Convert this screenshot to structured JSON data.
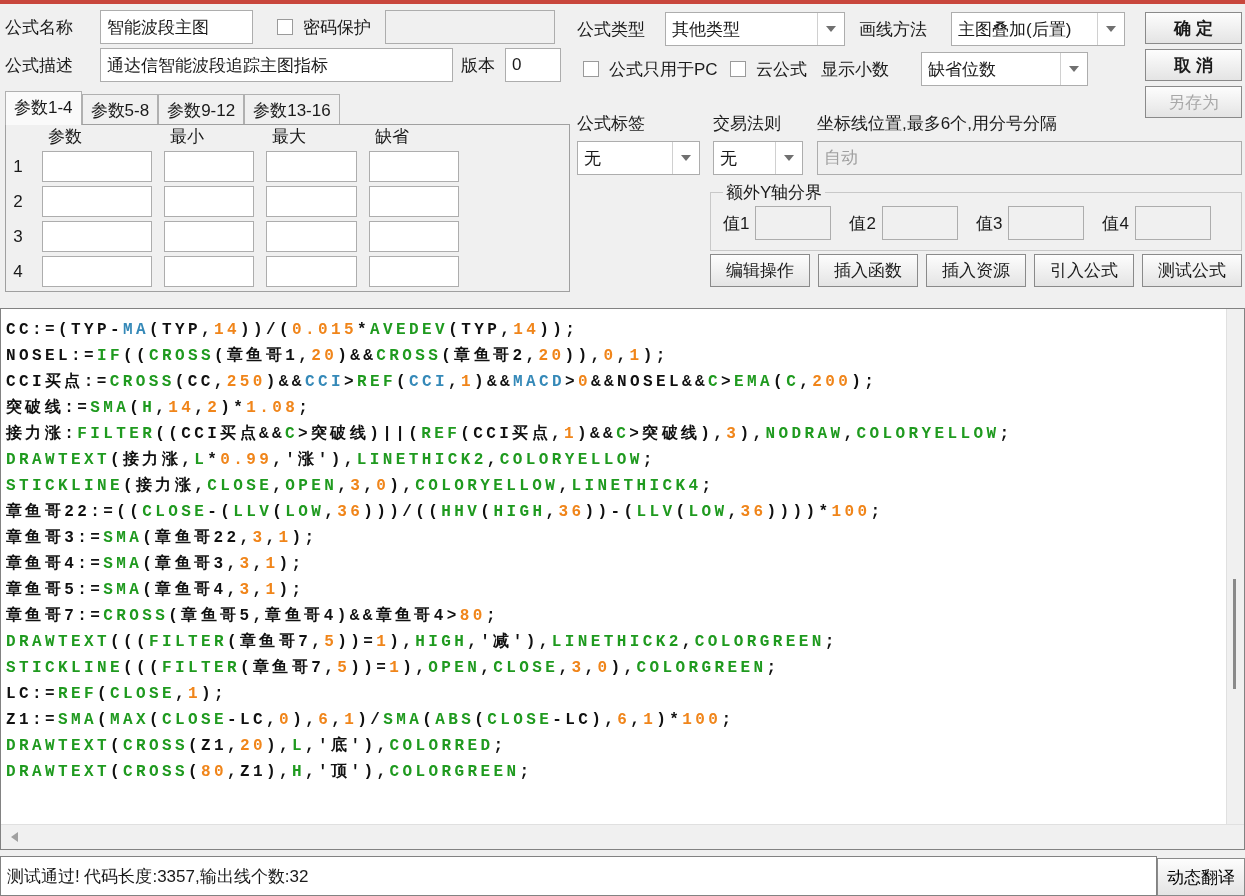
{
  "form": {
    "name_label": "公式名称",
    "name": "智能波段主图",
    "password": {
      "label": "密码保护",
      "checked": false
    },
    "desc_label": "公式描述",
    "description": "通达信智能波段追踪主图指标",
    "version_label": "版本",
    "version": "0"
  },
  "param_tabs": [
    {
      "label": "参数1-4",
      "selected": true
    },
    {
      "label": "参数5-8",
      "selected": false
    },
    {
      "label": "参数9-12",
      "selected": false
    },
    {
      "label": "参数13-16",
      "selected": false
    }
  ],
  "param_columns": [
    "参数",
    "最小",
    "最大",
    "缺省"
  ],
  "param_rows": [
    "1",
    "2",
    "3",
    "4"
  ],
  "formula_type": {
    "label": "公式类型",
    "value": "其他类型"
  },
  "draw_method": {
    "label": "画线方法",
    "value": "主图叠加(后置)"
  },
  "options": [
    {
      "label": "公式只用于PC",
      "checked": false
    },
    {
      "label": "云公式",
      "checked": false
    }
  ],
  "decimals": {
    "label": "显示小数",
    "value": "缺省位数"
  },
  "buttons": [
    {
      "label": "确 定",
      "disabled": false
    },
    {
      "label": "取 消",
      "disabled": false
    },
    {
      "label": "另存为",
      "disabled": true
    }
  ],
  "tag": {
    "label": "公式标签",
    "value": "无"
  },
  "trade_rule": {
    "label": "交易法则",
    "value": "无"
  },
  "axis_lines": {
    "label": "坐标线位置,最多6个,用分号分隔",
    "placeholder": "自动",
    "disabled": true
  },
  "y_bounds": {
    "title": "额外Y轴分界",
    "fields": [
      "值1",
      "值2",
      "值3",
      "值4"
    ]
  },
  "actions": [
    "编辑操作",
    "插入函数",
    "插入资源",
    "引入公式",
    "测试公式"
  ],
  "code": [
    [
      {
        "kind": "plain",
        "text": "CC:=(TYP-"
      },
      {
        "kind": "builtin",
        "text": "MA"
      },
      {
        "kind": "plain",
        "text": "(TYP,"
      },
      {
        "kind": "number",
        "text": "14"
      },
      {
        "kind": "plain",
        "text": "))/("
      },
      {
        "kind": "number",
        "text": "0.015"
      },
      {
        "kind": "plain",
        "text": "*"
      },
      {
        "kind": "function",
        "text": "AVEDEV"
      },
      {
        "kind": "plain",
        "text": "(TYP,"
      },
      {
        "kind": "number",
        "text": "14"
      },
      {
        "kind": "plain",
        "text": "));"
      }
    ],
    [
      {
        "kind": "plain",
        "text": "NOSEL:="
      },
      {
        "kind": "function",
        "text": "IF"
      },
      {
        "kind": "plain",
        "text": "(("
      },
      {
        "kind": "function",
        "text": "CROSS"
      },
      {
        "kind": "plain",
        "text": "(章鱼哥1,"
      },
      {
        "kind": "number",
        "text": "20"
      },
      {
        "kind": "plain",
        "text": ")&&"
      },
      {
        "kind": "function",
        "text": "CROSS"
      },
      {
        "kind": "plain",
        "text": "(章鱼哥2,"
      },
      {
        "kind": "number",
        "text": "20"
      },
      {
        "kind": "plain",
        "text": ")),"
      },
      {
        "kind": "number",
        "text": "0"
      },
      {
        "kind": "plain",
        "text": ","
      },
      {
        "kind": "number",
        "text": "1"
      },
      {
        "kind": "plain",
        "text": ");"
      }
    ],
    [
      {
        "kind": "plain",
        "text": "CCI买点:="
      },
      {
        "kind": "function",
        "text": "CROSS"
      },
      {
        "kind": "plain",
        "text": "(CC,"
      },
      {
        "kind": "number",
        "text": "250"
      },
      {
        "kind": "plain",
        "text": ")&&"
      },
      {
        "kind": "builtin",
        "text": "CCI"
      },
      {
        "kind": "plain",
        "text": ">"
      },
      {
        "kind": "function",
        "text": "REF"
      },
      {
        "kind": "plain",
        "text": "("
      },
      {
        "kind": "builtin",
        "text": "CCI"
      },
      {
        "kind": "plain",
        "text": ","
      },
      {
        "kind": "number",
        "text": "1"
      },
      {
        "kind": "plain",
        "text": ")&&"
      },
      {
        "kind": "builtin",
        "text": "MACD"
      },
      {
        "kind": "plain",
        "text": ">"
      },
      {
        "kind": "number",
        "text": "0"
      },
      {
        "kind": "plain",
        "text": "&&NOSEL&&"
      },
      {
        "kind": "function",
        "text": "C"
      },
      {
        "kind": "plain",
        "text": ">"
      },
      {
        "kind": "function",
        "text": "EMA"
      },
      {
        "kind": "plain",
        "text": "("
      },
      {
        "kind": "function",
        "text": "C"
      },
      {
        "kind": "plain",
        "text": ","
      },
      {
        "kind": "number",
        "text": "200"
      },
      {
        "kind": "plain",
        "text": ");"
      }
    ],
    [
      {
        "kind": "plain",
        "text": "突破线:="
      },
      {
        "kind": "function",
        "text": "SMA"
      },
      {
        "kind": "plain",
        "text": "("
      },
      {
        "kind": "function",
        "text": "H"
      },
      {
        "kind": "plain",
        "text": ","
      },
      {
        "kind": "number",
        "text": "14"
      },
      {
        "kind": "plain",
        "text": ","
      },
      {
        "kind": "number",
        "text": "2"
      },
      {
        "kind": "plain",
        "text": ")*"
      },
      {
        "kind": "number",
        "text": "1.08"
      },
      {
        "kind": "plain",
        "text": ";"
      }
    ],
    [
      {
        "kind": "plain",
        "text": "接力涨:"
      },
      {
        "kind": "function",
        "text": "FILTER"
      },
      {
        "kind": "plain",
        "text": "((CCI买点&&"
      },
      {
        "kind": "function",
        "text": "C"
      },
      {
        "kind": "plain",
        "text": ">突破线)||("
      },
      {
        "kind": "function",
        "text": "REF"
      },
      {
        "kind": "plain",
        "text": "(CCI买点,"
      },
      {
        "kind": "number",
        "text": "1"
      },
      {
        "kind": "plain",
        "text": ")&&"
      },
      {
        "kind": "function",
        "text": "C"
      },
      {
        "kind": "plain",
        "text": ">突破线),"
      },
      {
        "kind": "number",
        "text": "3"
      },
      {
        "kind": "plain",
        "text": "),"
      },
      {
        "kind": "function",
        "text": "NODRAW"
      },
      {
        "kind": "plain",
        "text": ","
      },
      {
        "kind": "function",
        "text": "COLORYELLOW"
      },
      {
        "kind": "plain",
        "text": ";"
      }
    ],
    [
      {
        "kind": "function",
        "text": "DRAWTEXT"
      },
      {
        "kind": "plain",
        "text": "(接力涨,"
      },
      {
        "kind": "function",
        "text": "L"
      },
      {
        "kind": "plain",
        "text": "*"
      },
      {
        "kind": "number",
        "text": "0.99"
      },
      {
        "kind": "plain",
        "text": ",'涨'),"
      },
      {
        "kind": "function",
        "text": "LINETHICK2"
      },
      {
        "kind": "plain",
        "text": ","
      },
      {
        "kind": "function",
        "text": "COLORYELLOW"
      },
      {
        "kind": "plain",
        "text": ";"
      }
    ],
    [
      {
        "kind": "function",
        "text": "STICKLINE"
      },
      {
        "kind": "plain",
        "text": "(接力涨,"
      },
      {
        "kind": "function",
        "text": "CLOSE"
      },
      {
        "kind": "plain",
        "text": ","
      },
      {
        "kind": "function",
        "text": "OPEN"
      },
      {
        "kind": "plain",
        "text": ","
      },
      {
        "kind": "number",
        "text": "3"
      },
      {
        "kind": "plain",
        "text": ","
      },
      {
        "kind": "number",
        "text": "0"
      },
      {
        "kind": "plain",
        "text": "),"
      },
      {
        "kind": "function",
        "text": "COLORYELLOW"
      },
      {
        "kind": "plain",
        "text": ","
      },
      {
        "kind": "function",
        "text": "LINETHICK4"
      },
      {
        "kind": "plain",
        "text": ";"
      }
    ],
    [
      {
        "kind": "plain",
        "text": "章鱼哥22:=(("
      },
      {
        "kind": "function",
        "text": "CLOSE"
      },
      {
        "kind": "plain",
        "text": "-("
      },
      {
        "kind": "function",
        "text": "LLV"
      },
      {
        "kind": "plain",
        "text": "("
      },
      {
        "kind": "function",
        "text": "LOW"
      },
      {
        "kind": "plain",
        "text": ","
      },
      {
        "kind": "number",
        "text": "36"
      },
      {
        "kind": "plain",
        "text": ")))/(("
      },
      {
        "kind": "function",
        "text": "HHV"
      },
      {
        "kind": "plain",
        "text": "("
      },
      {
        "kind": "function",
        "text": "HIGH"
      },
      {
        "kind": "plain",
        "text": ","
      },
      {
        "kind": "number",
        "text": "36"
      },
      {
        "kind": "plain",
        "text": "))-("
      },
      {
        "kind": "function",
        "text": "LLV"
      },
      {
        "kind": "plain",
        "text": "("
      },
      {
        "kind": "function",
        "text": "LOW"
      },
      {
        "kind": "plain",
        "text": ","
      },
      {
        "kind": "number",
        "text": "36"
      },
      {
        "kind": "plain",
        "text": "))))*"
      },
      {
        "kind": "number",
        "text": "100"
      },
      {
        "kind": "plain",
        "text": ";"
      }
    ],
    [
      {
        "kind": "plain",
        "text": "章鱼哥3:="
      },
      {
        "kind": "function",
        "text": "SMA"
      },
      {
        "kind": "plain",
        "text": "(章鱼哥22,"
      },
      {
        "kind": "number",
        "text": "3"
      },
      {
        "kind": "plain",
        "text": ","
      },
      {
        "kind": "number",
        "text": "1"
      },
      {
        "kind": "plain",
        "text": ");"
      }
    ],
    [
      {
        "kind": "plain",
        "text": "章鱼哥4:="
      },
      {
        "kind": "function",
        "text": "SMA"
      },
      {
        "kind": "plain",
        "text": "(章鱼哥3,"
      },
      {
        "kind": "number",
        "text": "3"
      },
      {
        "kind": "plain",
        "text": ","
      },
      {
        "kind": "number",
        "text": "1"
      },
      {
        "kind": "plain",
        "text": ");"
      }
    ],
    [
      {
        "kind": "plain",
        "text": "章鱼哥5:="
      },
      {
        "kind": "function",
        "text": "SMA"
      },
      {
        "kind": "plain",
        "text": "(章鱼哥4,"
      },
      {
        "kind": "number",
        "text": "3"
      },
      {
        "kind": "plain",
        "text": ","
      },
      {
        "kind": "number",
        "text": "1"
      },
      {
        "kind": "plain",
        "text": ");"
      }
    ],
    [
      {
        "kind": "plain",
        "text": "章鱼哥7:="
      },
      {
        "kind": "function",
        "text": "CROSS"
      },
      {
        "kind": "plain",
        "text": "(章鱼哥5,章鱼哥4)&&章鱼哥4>"
      },
      {
        "kind": "number",
        "text": "80"
      },
      {
        "kind": "plain",
        "text": ";"
      }
    ],
    [
      {
        "kind": "function",
        "text": "DRAWTEXT"
      },
      {
        "kind": "plain",
        "text": "((("
      },
      {
        "kind": "function",
        "text": "FILTER"
      },
      {
        "kind": "plain",
        "text": "(章鱼哥7,"
      },
      {
        "kind": "number",
        "text": "5"
      },
      {
        "kind": "plain",
        "text": "))="
      },
      {
        "kind": "number",
        "text": "1"
      },
      {
        "kind": "plain",
        "text": "),"
      },
      {
        "kind": "function",
        "text": "HIGH"
      },
      {
        "kind": "plain",
        "text": ",'减'),"
      },
      {
        "kind": "function",
        "text": "LINETHICK2"
      },
      {
        "kind": "plain",
        "text": ","
      },
      {
        "kind": "function",
        "text": "COLORGREEN"
      },
      {
        "kind": "plain",
        "text": ";"
      }
    ],
    [
      {
        "kind": "function",
        "text": "STICKLINE"
      },
      {
        "kind": "plain",
        "text": "((("
      },
      {
        "kind": "function",
        "text": "FILTER"
      },
      {
        "kind": "plain",
        "text": "(章鱼哥7,"
      },
      {
        "kind": "number",
        "text": "5"
      },
      {
        "kind": "plain",
        "text": "))="
      },
      {
        "kind": "number",
        "text": "1"
      },
      {
        "kind": "plain",
        "text": "),"
      },
      {
        "kind": "function",
        "text": "OPEN"
      },
      {
        "kind": "plain",
        "text": ","
      },
      {
        "kind": "function",
        "text": "CLOSE"
      },
      {
        "kind": "plain",
        "text": ","
      },
      {
        "kind": "number",
        "text": "3"
      },
      {
        "kind": "plain",
        "text": ","
      },
      {
        "kind": "number",
        "text": "0"
      },
      {
        "kind": "plain",
        "text": "),"
      },
      {
        "kind": "function",
        "text": "COLORGREEN"
      },
      {
        "kind": "plain",
        "text": ";"
      }
    ],
    [
      {
        "kind": "plain",
        "text": "LC:="
      },
      {
        "kind": "function",
        "text": "REF"
      },
      {
        "kind": "plain",
        "text": "("
      },
      {
        "kind": "function",
        "text": "CLOSE"
      },
      {
        "kind": "plain",
        "text": ","
      },
      {
        "kind": "number",
        "text": "1"
      },
      {
        "kind": "plain",
        "text": ");"
      }
    ],
    [
      {
        "kind": "plain",
        "text": "Z1:="
      },
      {
        "kind": "function",
        "text": "SMA"
      },
      {
        "kind": "plain",
        "text": "("
      },
      {
        "kind": "function",
        "text": "MAX"
      },
      {
        "kind": "plain",
        "text": "("
      },
      {
        "kind": "function",
        "text": "CLOSE"
      },
      {
        "kind": "plain",
        "text": "-LC,"
      },
      {
        "kind": "number",
        "text": "0"
      },
      {
        "kind": "plain",
        "text": "),"
      },
      {
        "kind": "number",
        "text": "6"
      },
      {
        "kind": "plain",
        "text": ","
      },
      {
        "kind": "number",
        "text": "1"
      },
      {
        "kind": "plain",
        "text": ")/"
      },
      {
        "kind": "function",
        "text": "SMA"
      },
      {
        "kind": "plain",
        "text": "("
      },
      {
        "kind": "function",
        "text": "ABS"
      },
      {
        "kind": "plain",
        "text": "("
      },
      {
        "kind": "function",
        "text": "CLOSE"
      },
      {
        "kind": "plain",
        "text": "-LC),"
      },
      {
        "kind": "number",
        "text": "6"
      },
      {
        "kind": "plain",
        "text": ","
      },
      {
        "kind": "number",
        "text": "1"
      },
      {
        "kind": "plain",
        "text": ")*"
      },
      {
        "kind": "number",
        "text": "100"
      },
      {
        "kind": "plain",
        "text": ";"
      }
    ],
    [
      {
        "kind": "function",
        "text": "DRAWTEXT"
      },
      {
        "kind": "plain",
        "text": "("
      },
      {
        "kind": "function",
        "text": "CROSS"
      },
      {
        "kind": "plain",
        "text": "(Z1,"
      },
      {
        "kind": "number",
        "text": "20"
      },
      {
        "kind": "plain",
        "text": "),"
      },
      {
        "kind": "function",
        "text": "L"
      },
      {
        "kind": "plain",
        "text": ",'底'),"
      },
      {
        "kind": "function",
        "text": "COLORRED"
      },
      {
        "kind": "plain",
        "text": ";"
      }
    ],
    [
      {
        "kind": "function",
        "text": "DRAWTEXT"
      },
      {
        "kind": "plain",
        "text": "("
      },
      {
        "kind": "function",
        "text": "CROSS"
      },
      {
        "kind": "plain",
        "text": "("
      },
      {
        "kind": "number",
        "text": "80"
      },
      {
        "kind": "plain",
        "text": ",Z1),"
      },
      {
        "kind": "function",
        "text": "H"
      },
      {
        "kind": "plain",
        "text": ",'顶'),"
      },
      {
        "kind": "function",
        "text": "COLORGREEN"
      },
      {
        "kind": "plain",
        "text": ";"
      }
    ]
  ],
  "status": "测试通过! 代码长度:3357,输出线个数:32",
  "translate_button": "动态翻译"
}
